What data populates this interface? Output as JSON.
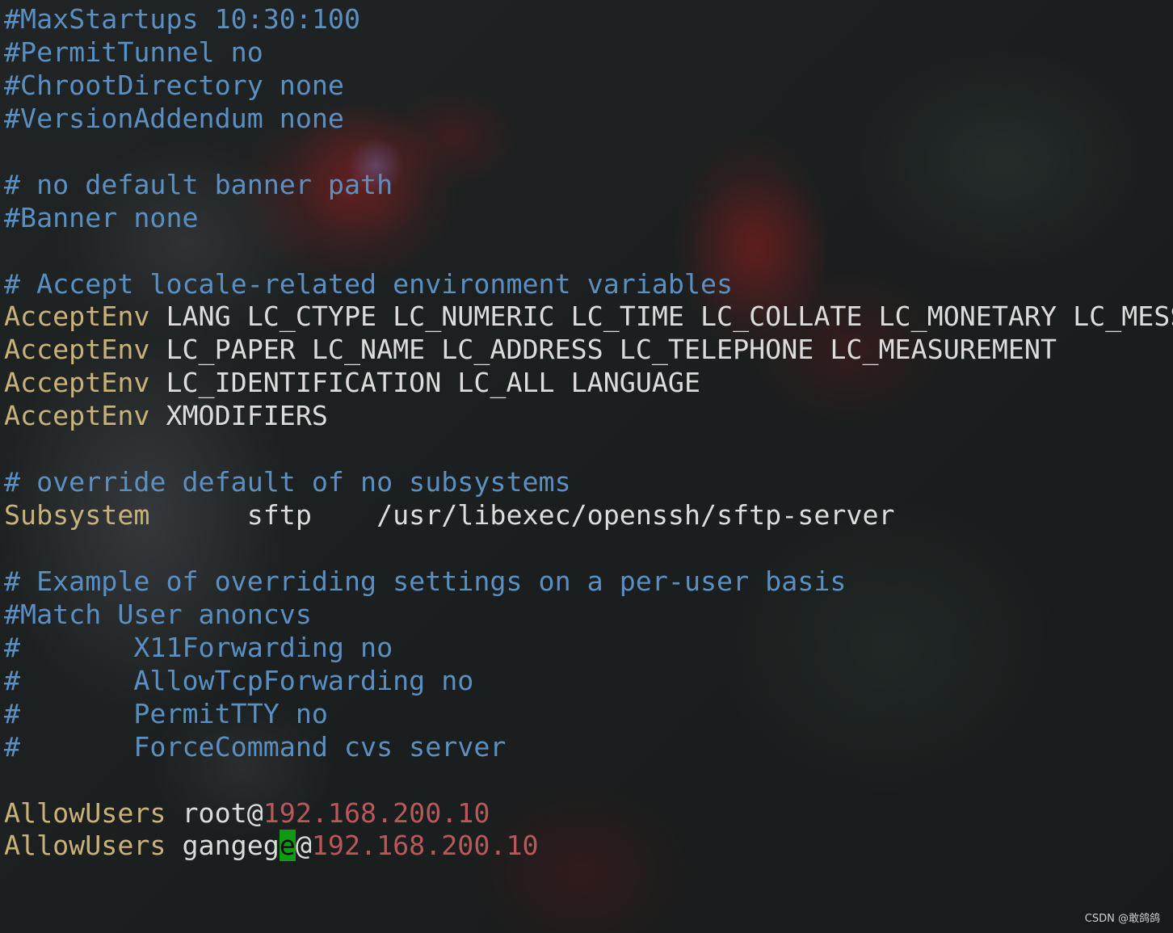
{
  "terminal": {
    "lines": [
      {
        "segments": [
          {
            "text": "#MaxStartups 10:30:100",
            "style": "comment"
          }
        ]
      },
      {
        "segments": [
          {
            "text": "#PermitTunnel no",
            "style": "comment"
          }
        ]
      },
      {
        "segments": [
          {
            "text": "#ChrootDirectory none",
            "style": "comment"
          }
        ]
      },
      {
        "segments": [
          {
            "text": "#VersionAddendum none",
            "style": "comment"
          }
        ]
      },
      {
        "segments": []
      },
      {
        "segments": [
          {
            "text": "# no default banner path",
            "style": "comment"
          }
        ]
      },
      {
        "segments": [
          {
            "text": "#Banner none",
            "style": "comment"
          }
        ]
      },
      {
        "segments": []
      },
      {
        "segments": [
          {
            "text": "# Accept locale-related environment variables",
            "style": "comment"
          }
        ]
      },
      {
        "segments": [
          {
            "text": "AcceptEnv",
            "style": "keyword"
          },
          {
            "text": " LANG LC_CTYPE LC_NUMERIC LC_TIME LC_COLLATE LC_MONETARY LC_MESS",
            "style": "value"
          }
        ]
      },
      {
        "segments": [
          {
            "text": "AcceptEnv",
            "style": "keyword"
          },
          {
            "text": " LC_PAPER LC_NAME LC_ADDRESS LC_TELEPHONE LC_MEASUREMENT",
            "style": "value"
          }
        ]
      },
      {
        "segments": [
          {
            "text": "AcceptEnv",
            "style": "keyword"
          },
          {
            "text": " LC_IDENTIFICATION LC_ALL LANGUAGE",
            "style": "value"
          }
        ]
      },
      {
        "segments": [
          {
            "text": "AcceptEnv",
            "style": "keyword"
          },
          {
            "text": " XMODIFIERS",
            "style": "value"
          }
        ]
      },
      {
        "segments": []
      },
      {
        "segments": [
          {
            "text": "# override default of no subsystems",
            "style": "comment"
          }
        ]
      },
      {
        "segments": [
          {
            "text": "Subsystem",
            "style": "keyword"
          },
          {
            "text": "      sftp    /usr/libexec/openssh/sftp-server",
            "style": "value"
          }
        ]
      },
      {
        "segments": []
      },
      {
        "segments": [
          {
            "text": "# Example of overriding settings on a per-user basis",
            "style": "comment"
          }
        ]
      },
      {
        "segments": [
          {
            "text": "#Match User anoncvs",
            "style": "comment"
          }
        ]
      },
      {
        "segments": [
          {
            "text": "#       X11Forwarding no",
            "style": "comment"
          }
        ]
      },
      {
        "segments": [
          {
            "text": "#       AllowTcpForwarding no",
            "style": "comment"
          }
        ]
      },
      {
        "segments": [
          {
            "text": "#       PermitTTY no",
            "style": "comment"
          }
        ]
      },
      {
        "segments": [
          {
            "text": "#       ForceCommand cvs server",
            "style": "comment"
          }
        ]
      },
      {
        "segments": []
      },
      {
        "segments": [
          {
            "text": "AllowUsers",
            "style": "keyword"
          },
          {
            "text": " root@",
            "style": "value"
          },
          {
            "text": "192.168.200.10",
            "style": "ip"
          }
        ]
      },
      {
        "segments": [
          {
            "text": "AllowUsers",
            "style": "keyword"
          },
          {
            "text": " gangeg",
            "style": "value"
          },
          {
            "text": "e",
            "style": "cursor"
          },
          {
            "text": "@",
            "style": "value"
          },
          {
            "text": "192.168.200.10",
            "style": "ip"
          }
        ]
      }
    ]
  },
  "watermark": "CSDN @敢鸽鸽",
  "colors": {
    "comment": "#5b8fc2",
    "keyword": "#c8b27a",
    "value": "#dcdcdc",
    "ip": "#b8585a",
    "cursor": "#0f9a14",
    "background": "#1b1f1f"
  }
}
